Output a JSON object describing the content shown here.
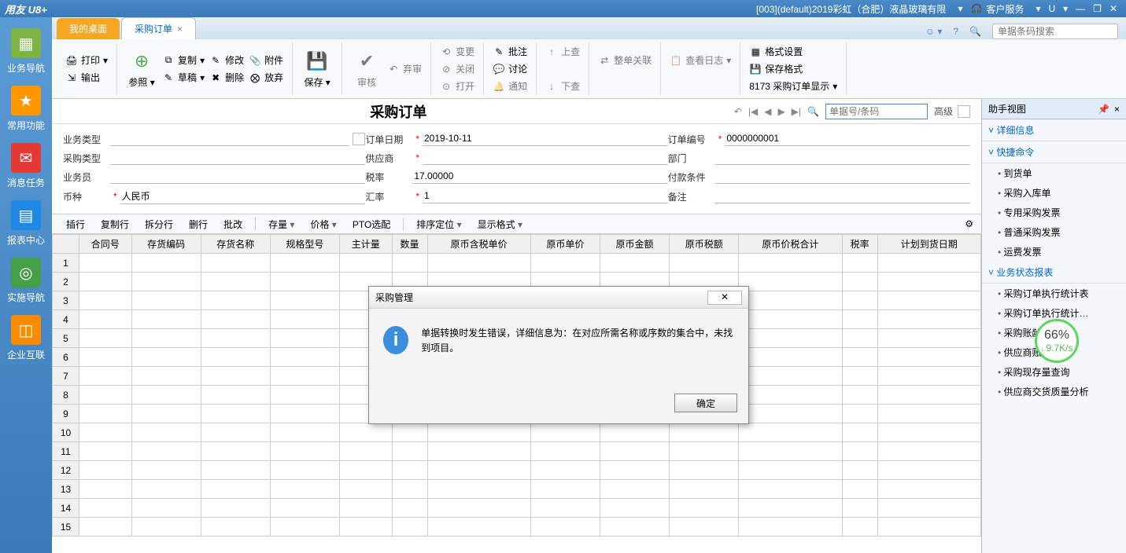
{
  "titlebar": {
    "app": "用友 U8+",
    "context": "[003](default)2019彩虹（合肥）液晶玻璃有限",
    "service": "客户服务",
    "u": "U"
  },
  "sidebar": [
    {
      "label": "业务导航",
      "color": "#7cb342"
    },
    {
      "label": "常用功能",
      "color": "#ff9800"
    },
    {
      "label": "消息任务",
      "color": "#e53935"
    },
    {
      "label": "报表中心",
      "color": "#1e88e5"
    },
    {
      "label": "实施导航",
      "color": "#43a047"
    },
    {
      "label": "企业互联",
      "color": "#fb8c00"
    }
  ],
  "tabs": {
    "desktop": "我的桌面",
    "active": "采购订单"
  },
  "search_placeholder": "单据条码搜索",
  "ribbon": {
    "print": "打印",
    "output": "输出",
    "ref": "参照",
    "copy": "复制",
    "modify": "修改",
    "attach": "附件",
    "draft": "草稿",
    "delete": "删除",
    "abandon": "放弃",
    "save": "保存",
    "audit": "审核",
    "giveup": "弃审",
    "change": "变更",
    "close": "关闭",
    "open": "打开",
    "approve": "批注",
    "discuss": "讨论",
    "notify": "通知",
    "up": "上查",
    "down": "下查",
    "wholeLink": "整单关联",
    "log": "查看日志",
    "fmt": "格式设置",
    "savefmt": "保存格式",
    "tpl": "8173 采购订单显示"
  },
  "doc": {
    "title": "采购订单",
    "search_ph": "单据号/条码",
    "adv": "高级",
    "fields": {
      "bizType": "业务类型",
      "poType": "采购类型",
      "salesman": "业务员",
      "currency": "币种",
      "currency_val": "人民币",
      "orderDate": "订单日期",
      "orderDate_val": "2019-10-11",
      "supplier": "供应商",
      "taxRate": "税率",
      "taxRate_val": "17.00000",
      "exRate": "汇率",
      "exRate_val": "1",
      "orderNo": "订单编号",
      "orderNo_val": "0000000001",
      "dept": "部门",
      "payTerm": "付款条件",
      "remark": "备注"
    }
  },
  "gridtb": {
    "insert": "插行",
    "copyrow": "复制行",
    "splitrow": "拆分行",
    "delrow": "删行",
    "batch": "批改",
    "stock": "存量",
    "price": "价格",
    "pto": "PTO选配",
    "sort": "排序定位",
    "dispfmt": "显示格式"
  },
  "cols": [
    "合同号",
    "存货编码",
    "存货名称",
    "规格型号",
    "主计量",
    "数量",
    "原币含税单价",
    "原币单价",
    "原币金额",
    "原币税额",
    "原币价税合计",
    "税率",
    "计划到货日期"
  ],
  "helper": {
    "title": "助手视图",
    "sec1": "详细信息",
    "sec2": "快捷命令",
    "cmds": [
      "到货单",
      "采购入库单",
      "专用采购发票",
      "普通采购发票",
      "运费发票"
    ],
    "sec3": "业务状态报表",
    "rpts": [
      "采购订单执行统计表",
      "采购订单执行统计…",
      "采购账龄分析",
      "供应商账龄分析",
      "采购现存量查询",
      "供应商交货质量分析"
    ]
  },
  "dialog": {
    "title": "采购管理",
    "msg": "单据转换时发生错误，详细信息为：在对应所需名称或序数的集合中，未找到项目。",
    "ok": "确定"
  },
  "speed": {
    "pct": "66%",
    "rate": "9.7K/s"
  }
}
